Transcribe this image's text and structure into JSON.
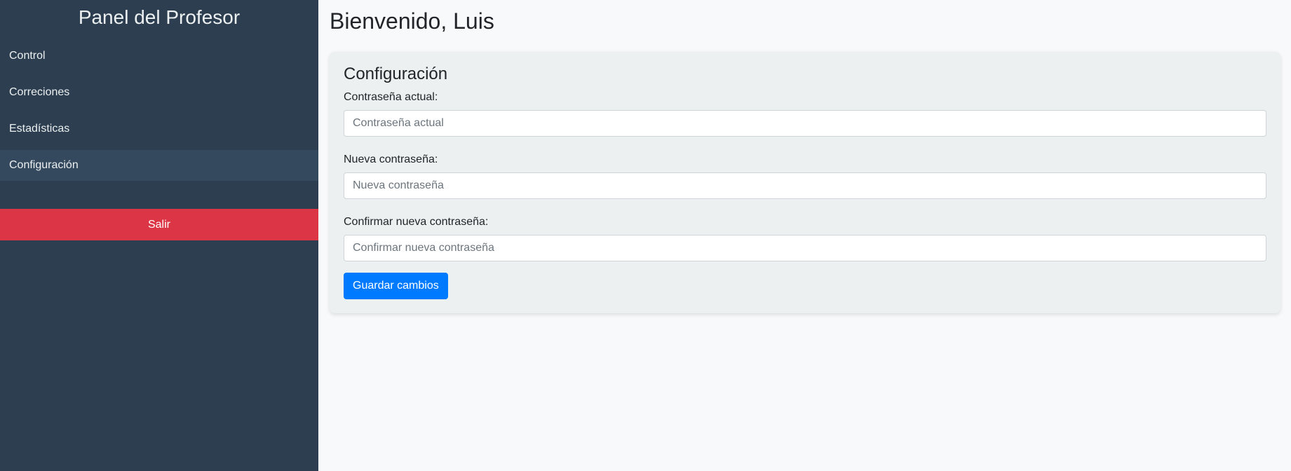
{
  "sidebar": {
    "title": "Panel del Profesor",
    "items": [
      {
        "label": "Control"
      },
      {
        "label": "Correciones"
      },
      {
        "label": "Estadísticas"
      },
      {
        "label": "Configuración",
        "active": true
      }
    ],
    "logout_label": "Salir"
  },
  "main": {
    "welcome": "Bienvenido, Luis",
    "card": {
      "title": "Configuración",
      "fields": [
        {
          "label": "Contraseña actual:",
          "placeholder": "Contraseña actual",
          "value": ""
        },
        {
          "label": "Nueva contraseña:",
          "placeholder": "Nueva contraseña",
          "value": ""
        },
        {
          "label": "Confirmar nueva contraseña:",
          "placeholder": "Confirmar nueva contraseña",
          "value": ""
        }
      ],
      "save_label": "Guardar cambios"
    }
  },
  "colors": {
    "sidebar_bg": "#2c3e50",
    "sidebar_active_bg": "#34495e",
    "logout_bg": "#dc3545",
    "primary": "#007bff",
    "card_bg": "#ecf0f1",
    "page_bg": "#f8f9fa"
  }
}
